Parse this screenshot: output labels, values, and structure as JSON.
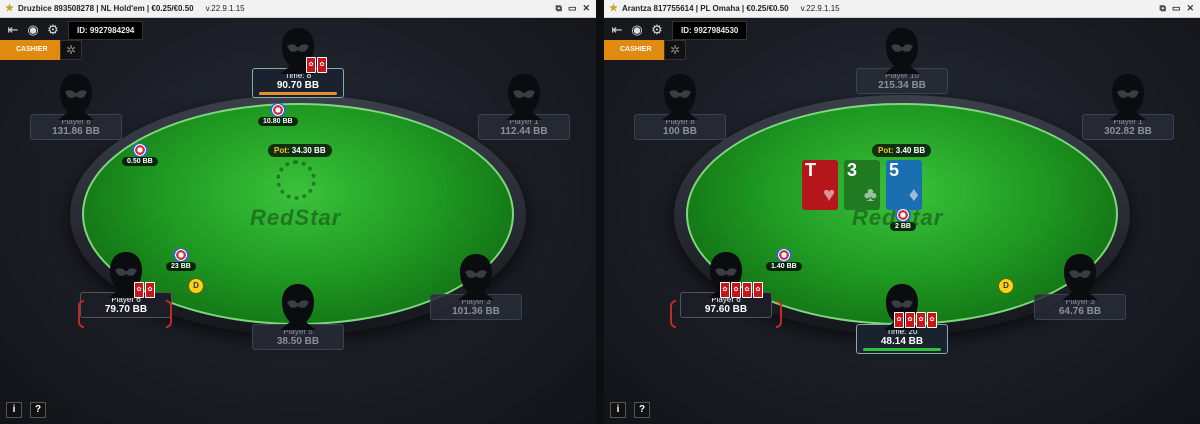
{
  "windows": [
    {
      "title": "Druzbice 893508278 | NL Hold'em | €0.25/€0.50",
      "version": "v.22.9.1.15",
      "table_id": "ID: 9927984294",
      "cashier_label": "CASHIER",
      "logo": "RedStar",
      "pot": {
        "label": "Pot:",
        "value": "34.30 BB"
      },
      "players": {
        "top": {
          "time": "Time: 8",
          "stack": "90.70 BB",
          "bet": "10.80 BB"
        },
        "p8": {
          "name": "Player 8",
          "stack": "131.86 BB",
          "bet": "0.50 BB"
        },
        "p1": {
          "name": "Player 1",
          "stack": "112.44 BB"
        },
        "p6": {
          "name": "Player 6",
          "stack": "79.70 BB",
          "bet": "23 BB"
        },
        "p5": {
          "name": "Player 5",
          "stack": "38.50 BB"
        },
        "p3": {
          "name": "Player 3",
          "stack": "101.36 BB"
        }
      },
      "dealer": "D"
    },
    {
      "title": "Arantza 817755614 | PL Omaha | €0.25/€0.50",
      "version": "v.22.9.1.15",
      "table_id": "ID: 9927984530",
      "cashier_label": "CASHIER",
      "logo": "RedStar",
      "pot": {
        "label": "Pot:",
        "value": "3.40 BB"
      },
      "board": [
        {
          "rank": "T",
          "suit": "♥",
          "color": "#b5161b"
        },
        {
          "rank": "3",
          "suit": "♣",
          "color": "#1f7a22"
        },
        {
          "rank": "5",
          "suit": "♦",
          "color": "#1a6fb0"
        }
      ],
      "players": {
        "p10": {
          "name": "Player 10",
          "stack": "215.34 BB"
        },
        "p8": {
          "name": "Player 8",
          "stack": "100 BB"
        },
        "p1": {
          "name": "Player 1",
          "stack": "302.82 BB"
        },
        "p6": {
          "name": "Player 6",
          "stack": "97.60 BB",
          "bet": "1.40 BB"
        },
        "bottom": {
          "time": "Time: 20",
          "stack": "48.14 BB",
          "bet": "2 BB"
        },
        "p3": {
          "name": "Player 3",
          "stack": "64.76 BB"
        }
      },
      "dealer": "D"
    }
  ],
  "footer": {
    "info": "i",
    "help": "?"
  },
  "colors": {
    "felt": "#1f9a22",
    "cashier": "#e08a10",
    "card_back": "#c8141b",
    "dealer": "#f7d21a"
  }
}
